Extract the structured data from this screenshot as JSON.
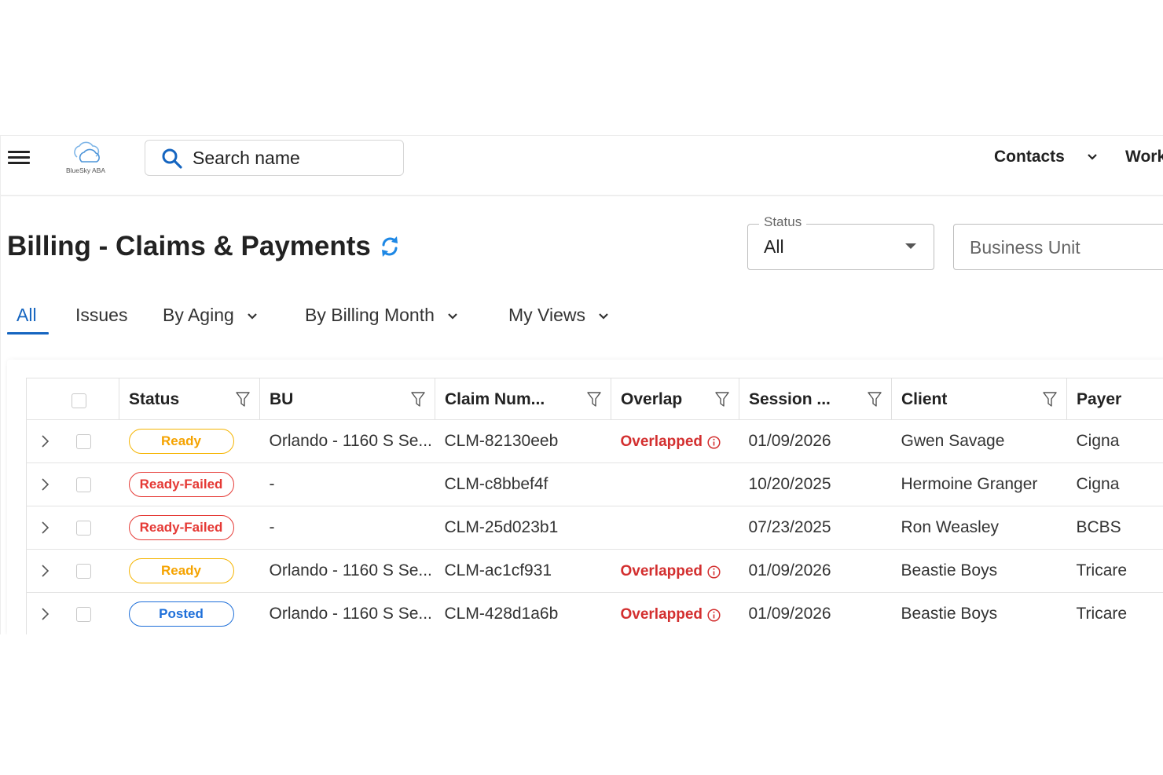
{
  "app": {
    "logo_text": "BlueSky ABA"
  },
  "search": {
    "placeholder": "Search name"
  },
  "nav": {
    "contacts_label": "Contacts",
    "work_label": "Work"
  },
  "page": {
    "title": "Billing - Claims & Payments"
  },
  "filters": {
    "status_label": "Status",
    "status_value": "All",
    "business_unit_placeholder": "Business Unit"
  },
  "tabs": [
    {
      "label": "All",
      "active": true
    },
    {
      "label": "Issues"
    },
    {
      "label": "By Aging",
      "has_dropdown": true
    },
    {
      "label": "By Billing Month",
      "has_dropdown": true
    },
    {
      "label": "My Views",
      "has_dropdown": true
    }
  ],
  "table": {
    "columns": [
      "Status",
      "BU",
      "Claim Num...",
      "Overlap",
      "Session ...",
      "Client",
      "Payer"
    ],
    "rows": [
      {
        "status": "Ready",
        "status_type": "ready",
        "bu": "Orlando - 1160 S Se...",
        "claim": "CLM-82130eeb",
        "overlap": "Overlapped",
        "session": "01/09/2026",
        "client": "Gwen Savage",
        "payer": "Cigna"
      },
      {
        "status": "Ready-Failed",
        "status_type": "failed",
        "bu": "-",
        "claim": "CLM-c8bbef4f",
        "overlap": "",
        "session": "10/20/2025",
        "client": "Hermoine Granger",
        "payer": "Cigna"
      },
      {
        "status": "Ready-Failed",
        "status_type": "failed",
        "bu": "-",
        "claim": "CLM-25d023b1",
        "overlap": "",
        "session": "07/23/2025",
        "client": "Ron Weasley",
        "payer": "BCBS"
      },
      {
        "status": "Ready",
        "status_type": "ready",
        "bu": "Orlando - 1160 S Se...",
        "claim": "CLM-ac1cf931",
        "overlap": "Overlapped",
        "session": "01/09/2026",
        "client": "Beastie Boys",
        "payer": "Tricare"
      },
      {
        "status": "Posted",
        "status_type": "posted",
        "bu": "Orlando - 1160 S Se...",
        "claim": "CLM-428d1a6b",
        "overlap": "Overlapped",
        "session": "01/09/2026",
        "client": "Beastie Boys",
        "payer": "Tricare"
      }
    ]
  },
  "colors": {
    "accent": "#1565c0",
    "ready": "#f5a300",
    "failed": "#e53935",
    "posted": "#1e6fd9",
    "overlap": "#d32f2f"
  },
  "icons": {
    "menu": "hamburger-icon",
    "search": "search-icon",
    "refresh": "refresh-icon",
    "filter": "filter-icon",
    "expand": "chevron-right-icon",
    "info": "info-icon"
  }
}
